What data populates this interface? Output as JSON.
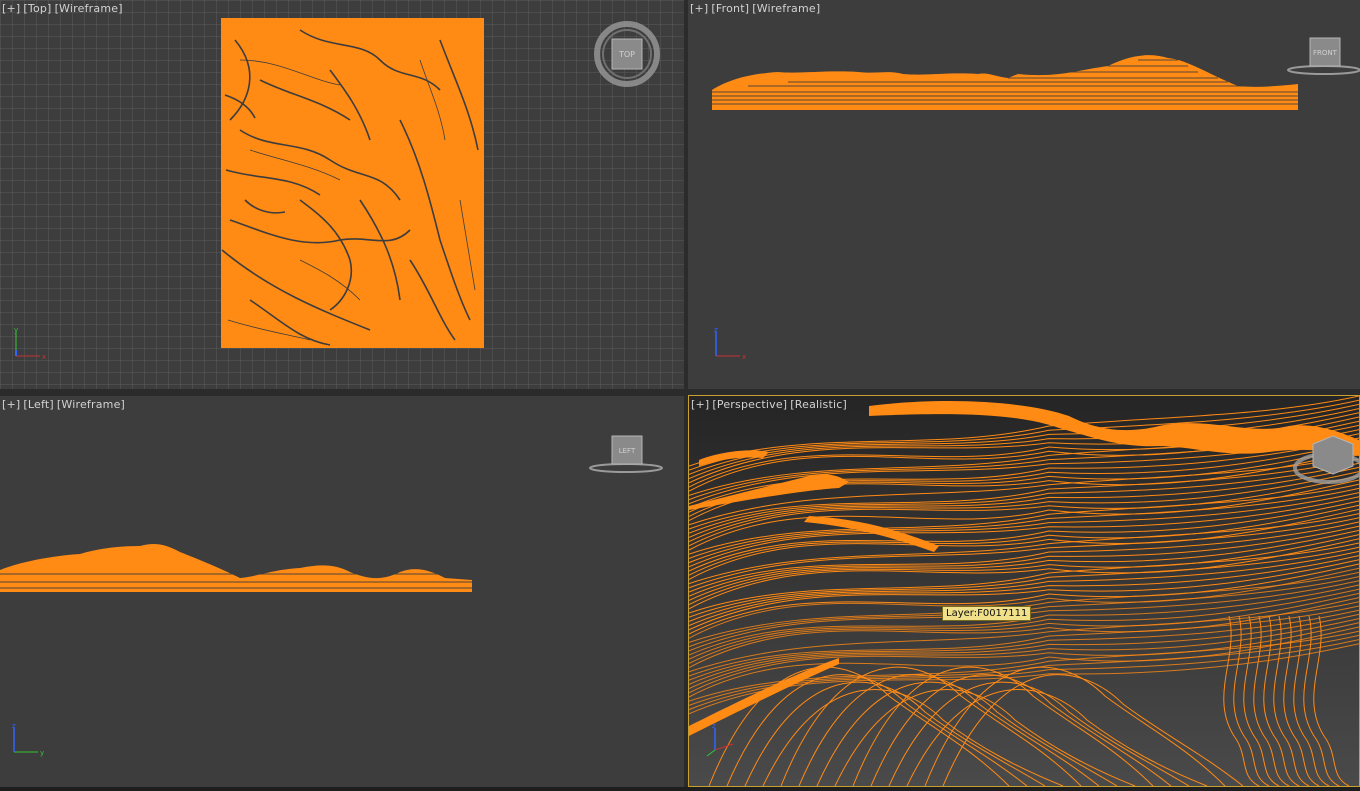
{
  "viewports": {
    "top": {
      "label": [
        "[+]",
        "[Top]",
        "[Wireframe]"
      ],
      "cube": "TOP"
    },
    "front": {
      "label": [
        "[+]",
        "[Front]",
        "[Wireframe]"
      ],
      "cube": "FRONT"
    },
    "left": {
      "label": [
        "[+]",
        "[Left]",
        "[Wireframe]"
      ],
      "cube": "LEFT"
    },
    "perspective": {
      "label": [
        "[+]",
        "[Perspective]",
        "[Realistic]"
      ],
      "tooltip": "Layer:F0017111"
    }
  },
  "axes": {
    "x": "x",
    "y": "y",
    "z": "z"
  },
  "colors": {
    "terrain": "#ff8a14",
    "grid": "#5a5a5a",
    "viewport_bg": "#3d3d3d",
    "active_border": "#c8a032"
  }
}
